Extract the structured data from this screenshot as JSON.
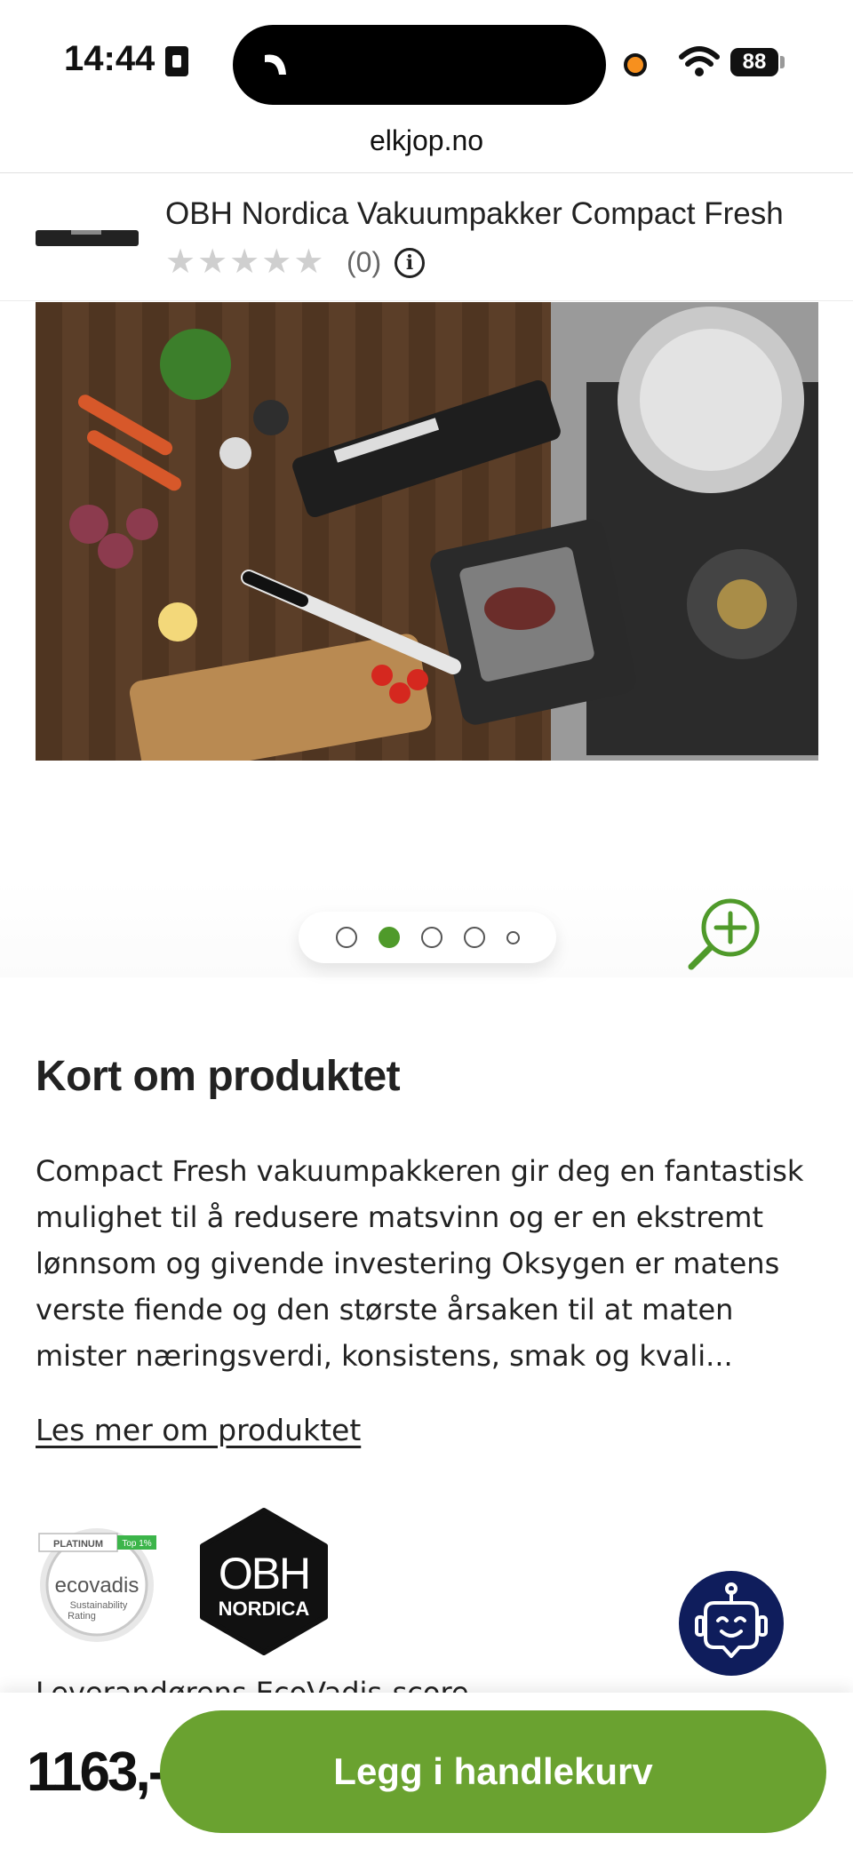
{
  "status_bar": {
    "time": "14:44",
    "battery": "88"
  },
  "browser": {
    "url": "elkjop.no"
  },
  "product_header": {
    "name": "OBH Nordica Vakuumpakker Compact Fresh",
    "rating_stars": 0,
    "review_count": "(0)",
    "info_icon": "info-icon"
  },
  "gallery": {
    "image_count": 5,
    "active_index": 1,
    "zoom_icon": "zoom-in-icon"
  },
  "about": {
    "title": "Kort om produktet",
    "description": "Compact Fresh vakuumpakkeren gir deg en fantastisk mulighet til å redusere matsvinn og er en ekstremt lønnsom og givende investering Oksygen er matens verste fiende og den største årsaken til at maten mister næringsverdi, konsistens, smak og kvali...",
    "read_more": "Les mer om produktet"
  },
  "badges": {
    "ecovadis_tier": "PLATINUM",
    "ecovadis_rank": "Top 1%",
    "ecovadis_brand": "ecovadis",
    "ecovadis_sub1": "Sustainability",
    "ecovadis_sub2": "Rating",
    "brand_line1": "OBH",
    "brand_line2": "NORDICA"
  },
  "supplier": {
    "text": "Leverandørens EcoVadis-score"
  },
  "chat": {
    "icon": "robot-icon"
  },
  "purchase": {
    "price": "1163,-",
    "add_to_cart": "Legg i handlekurv"
  },
  "colors": {
    "accent_green": "#6aa230",
    "chat_navy": "#0f1d5c"
  }
}
